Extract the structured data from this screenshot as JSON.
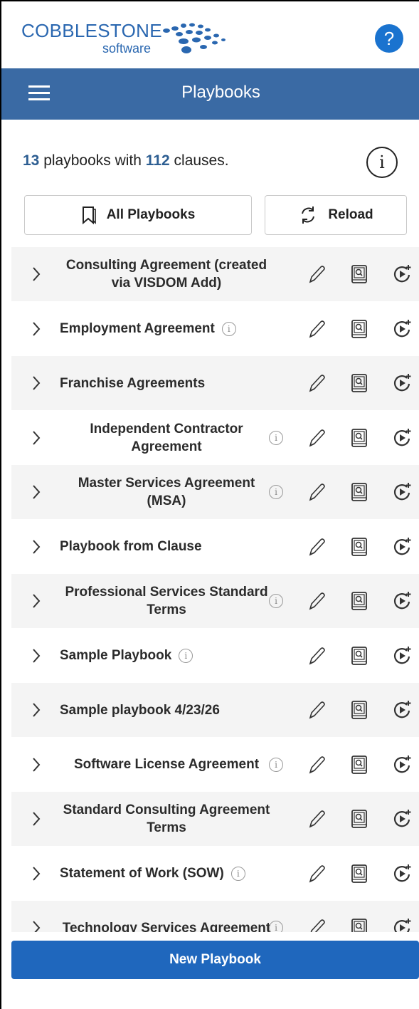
{
  "brand": {
    "name": "COBBLESTONE",
    "sub": "software"
  },
  "help": {
    "label": "?"
  },
  "header": {
    "title": "Playbooks"
  },
  "summary": {
    "playbook_count": "13",
    "text1": "playbooks with",
    "clause_count": "112",
    "text2": "clauses."
  },
  "buttons": {
    "all_playbooks": "All Playbooks",
    "reload": "Reload",
    "new_playbook": "New Playbook"
  },
  "info_glyph": "i",
  "colors": {
    "header_bg": "#3a6aa4",
    "accent": "#2d5e92",
    "primary_button": "#1f67bd",
    "help": "#1a73cf"
  },
  "playbooks": [
    {
      "name": "Consulting Agreement (created via VISDOM Add)",
      "info": false,
      "centered": true
    },
    {
      "name": "Employment Agreement",
      "info": true,
      "centered": false
    },
    {
      "name": "Franchise Agreements",
      "info": false,
      "centered": false
    },
    {
      "name": "Independent Contractor Agreement",
      "info": true,
      "centered": true
    },
    {
      "name": "Master Services Agreement (MSA)",
      "info": true,
      "centered": true
    },
    {
      "name": "Playbook from Clause",
      "info": false,
      "centered": false
    },
    {
      "name": "Professional Services Standard Terms",
      "info": true,
      "centered": true
    },
    {
      "name": "Sample Playbook",
      "info": true,
      "centered": false
    },
    {
      "name": "Sample playbook 4/23/26",
      "info": false,
      "centered": false
    },
    {
      "name": "Software License Agreement",
      "info": true,
      "centered": true
    },
    {
      "name": "Standard Consulting Agreement Terms",
      "info": false,
      "centered": true
    },
    {
      "name": "Statement of Work (SOW)",
      "info": true,
      "centered": false
    },
    {
      "name": "Technology Services Agreement",
      "info": true,
      "centered": true
    }
  ]
}
